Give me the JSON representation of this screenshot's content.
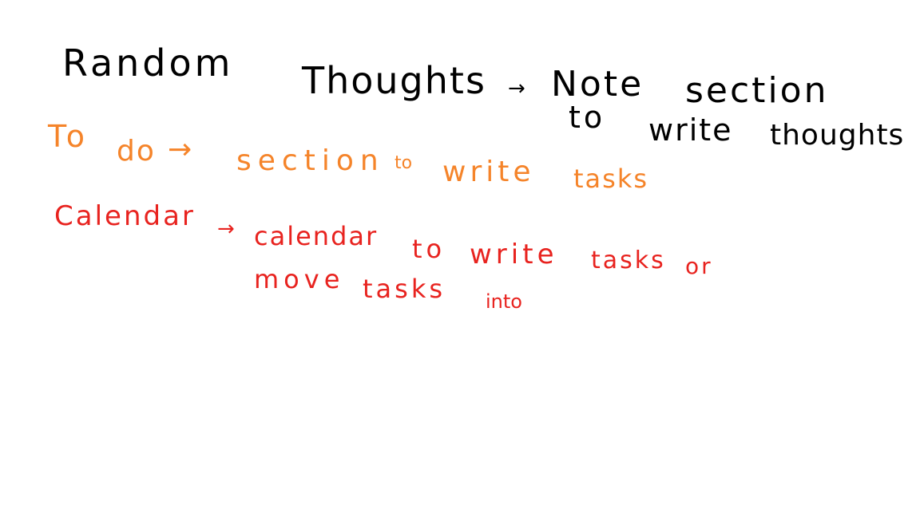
{
  "notes": {
    "line1": {
      "heading": "Random",
      "heading2": "Thoughts",
      "arrow": "→",
      "target1": "Note",
      "target2": "section"
    },
    "line2": {
      "w1": "to",
      "w2": "write",
      "w3": "thoughts"
    },
    "line3": {
      "heading1": "To",
      "heading2": "do",
      "arrow": "→",
      "w1": "section",
      "w2": "to",
      "w3": "write",
      "w4": "tasks"
    },
    "line4": {
      "heading": "Calendar",
      "arrow": "→",
      "w1": "calendar",
      "w2": "to",
      "w3": "write",
      "w4": "tasks",
      "w5": "or"
    },
    "line5": {
      "w1": "move",
      "w2": "tasks",
      "w3": "into"
    }
  },
  "colors": {
    "background": "#ffffff",
    "black_ink": "#000000",
    "orange_ink": "#f5842a",
    "red_ink": "#e8231f"
  }
}
